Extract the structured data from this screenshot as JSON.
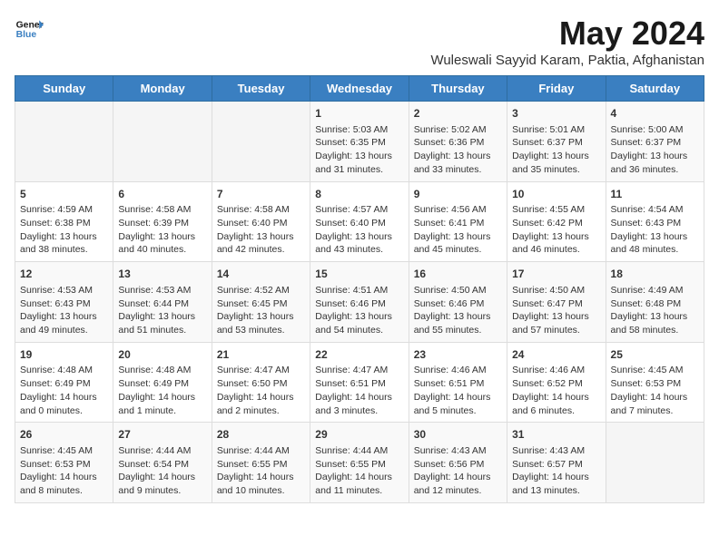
{
  "app": {
    "logo_line1": "General",
    "logo_line2": "Blue",
    "main_title": "May 2024",
    "subtitle": "Wuleswali Sayyid Karam, Paktia, Afghanistan"
  },
  "calendar": {
    "headers": [
      "Sunday",
      "Monday",
      "Tuesday",
      "Wednesday",
      "Thursday",
      "Friday",
      "Saturday"
    ],
    "rows": [
      [
        {
          "day": "",
          "info": ""
        },
        {
          "day": "",
          "info": ""
        },
        {
          "day": "",
          "info": ""
        },
        {
          "day": "1",
          "info": "Sunrise: 5:03 AM\nSunset: 6:35 PM\nDaylight: 13 hours and 31 minutes."
        },
        {
          "day": "2",
          "info": "Sunrise: 5:02 AM\nSunset: 6:36 PM\nDaylight: 13 hours and 33 minutes."
        },
        {
          "day": "3",
          "info": "Sunrise: 5:01 AM\nSunset: 6:37 PM\nDaylight: 13 hours and 35 minutes."
        },
        {
          "day": "4",
          "info": "Sunrise: 5:00 AM\nSunset: 6:37 PM\nDaylight: 13 hours and 36 minutes."
        }
      ],
      [
        {
          "day": "5",
          "info": "Sunrise: 4:59 AM\nSunset: 6:38 PM\nDaylight: 13 hours and 38 minutes."
        },
        {
          "day": "6",
          "info": "Sunrise: 4:58 AM\nSunset: 6:39 PM\nDaylight: 13 hours and 40 minutes."
        },
        {
          "day": "7",
          "info": "Sunrise: 4:58 AM\nSunset: 6:40 PM\nDaylight: 13 hours and 42 minutes."
        },
        {
          "day": "8",
          "info": "Sunrise: 4:57 AM\nSunset: 6:40 PM\nDaylight: 13 hours and 43 minutes."
        },
        {
          "day": "9",
          "info": "Sunrise: 4:56 AM\nSunset: 6:41 PM\nDaylight: 13 hours and 45 minutes."
        },
        {
          "day": "10",
          "info": "Sunrise: 4:55 AM\nSunset: 6:42 PM\nDaylight: 13 hours and 46 minutes."
        },
        {
          "day": "11",
          "info": "Sunrise: 4:54 AM\nSunset: 6:43 PM\nDaylight: 13 hours and 48 minutes."
        }
      ],
      [
        {
          "day": "12",
          "info": "Sunrise: 4:53 AM\nSunset: 6:43 PM\nDaylight: 13 hours and 49 minutes."
        },
        {
          "day": "13",
          "info": "Sunrise: 4:53 AM\nSunset: 6:44 PM\nDaylight: 13 hours and 51 minutes."
        },
        {
          "day": "14",
          "info": "Sunrise: 4:52 AM\nSunset: 6:45 PM\nDaylight: 13 hours and 53 minutes."
        },
        {
          "day": "15",
          "info": "Sunrise: 4:51 AM\nSunset: 6:46 PM\nDaylight: 13 hours and 54 minutes."
        },
        {
          "day": "16",
          "info": "Sunrise: 4:50 AM\nSunset: 6:46 PM\nDaylight: 13 hours and 55 minutes."
        },
        {
          "day": "17",
          "info": "Sunrise: 4:50 AM\nSunset: 6:47 PM\nDaylight: 13 hours and 57 minutes."
        },
        {
          "day": "18",
          "info": "Sunrise: 4:49 AM\nSunset: 6:48 PM\nDaylight: 13 hours and 58 minutes."
        }
      ],
      [
        {
          "day": "19",
          "info": "Sunrise: 4:48 AM\nSunset: 6:49 PM\nDaylight: 14 hours and 0 minutes."
        },
        {
          "day": "20",
          "info": "Sunrise: 4:48 AM\nSunset: 6:49 PM\nDaylight: 14 hours and 1 minute."
        },
        {
          "day": "21",
          "info": "Sunrise: 4:47 AM\nSunset: 6:50 PM\nDaylight: 14 hours and 2 minutes."
        },
        {
          "day": "22",
          "info": "Sunrise: 4:47 AM\nSunset: 6:51 PM\nDaylight: 14 hours and 3 minutes."
        },
        {
          "day": "23",
          "info": "Sunrise: 4:46 AM\nSunset: 6:51 PM\nDaylight: 14 hours and 5 minutes."
        },
        {
          "day": "24",
          "info": "Sunrise: 4:46 AM\nSunset: 6:52 PM\nDaylight: 14 hours and 6 minutes."
        },
        {
          "day": "25",
          "info": "Sunrise: 4:45 AM\nSunset: 6:53 PM\nDaylight: 14 hours and 7 minutes."
        }
      ],
      [
        {
          "day": "26",
          "info": "Sunrise: 4:45 AM\nSunset: 6:53 PM\nDaylight: 14 hours and 8 minutes."
        },
        {
          "day": "27",
          "info": "Sunrise: 4:44 AM\nSunset: 6:54 PM\nDaylight: 14 hours and 9 minutes."
        },
        {
          "day": "28",
          "info": "Sunrise: 4:44 AM\nSunset: 6:55 PM\nDaylight: 14 hours and 10 minutes."
        },
        {
          "day": "29",
          "info": "Sunrise: 4:44 AM\nSunset: 6:55 PM\nDaylight: 14 hours and 11 minutes."
        },
        {
          "day": "30",
          "info": "Sunrise: 4:43 AM\nSunset: 6:56 PM\nDaylight: 14 hours and 12 minutes."
        },
        {
          "day": "31",
          "info": "Sunrise: 4:43 AM\nSunset: 6:57 PM\nDaylight: 14 hours and 13 minutes."
        },
        {
          "day": "",
          "info": ""
        }
      ]
    ]
  }
}
